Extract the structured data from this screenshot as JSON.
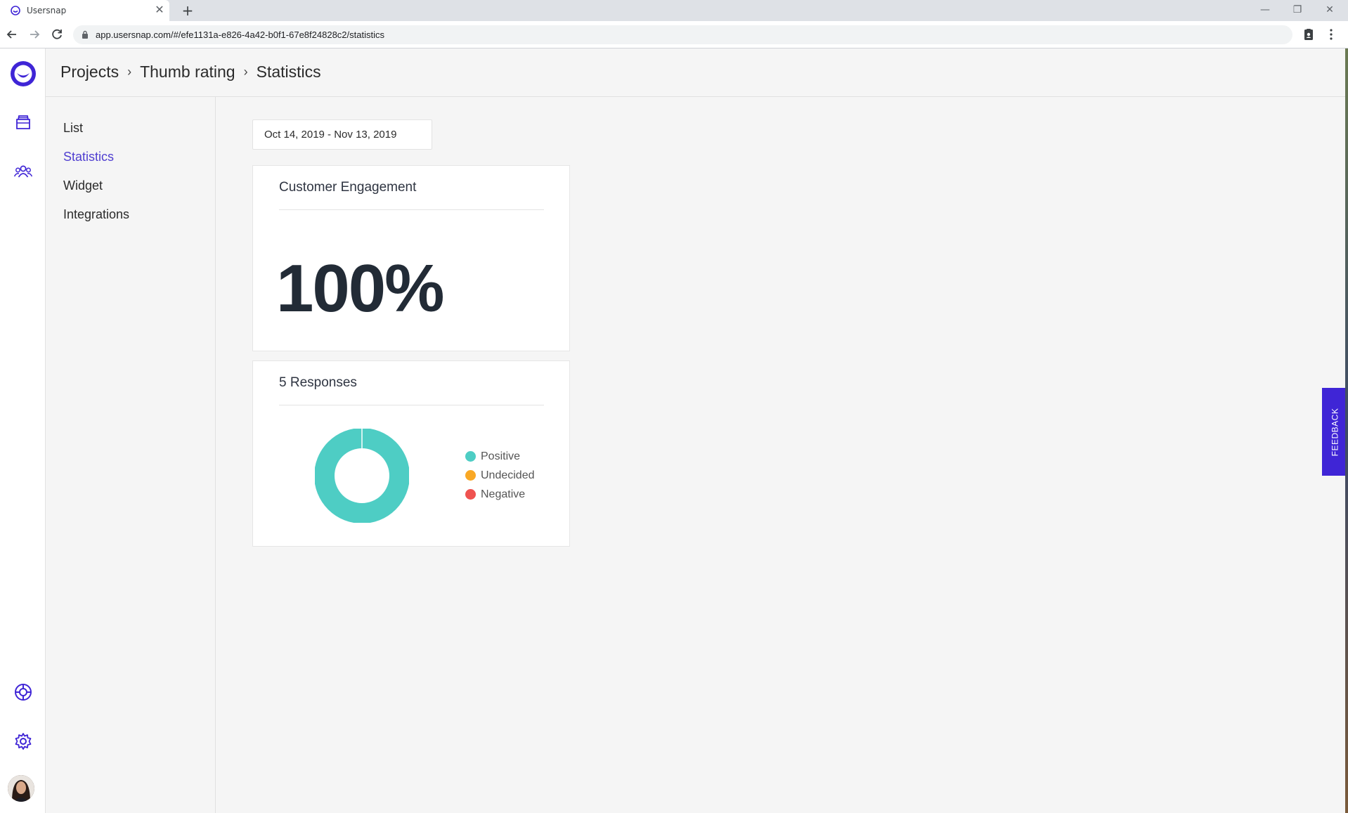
{
  "browser": {
    "tab_title": "Usersnap",
    "url": "app.usersnap.com/#/efe1131a-e826-4a42-b0f1-67e8f24828c2/statistics",
    "tab_close_glyph": "✕",
    "new_tab_glyph": "+",
    "minimize_glyph": "—",
    "restore_glyph": "❐",
    "close_glyph": "✕"
  },
  "breadcrumb": {
    "items": [
      "Projects",
      "Thumb rating",
      "Statistics"
    ],
    "separator": "›"
  },
  "subnav": {
    "items": [
      {
        "label": "List",
        "active": false
      },
      {
        "label": "Statistics",
        "active": true
      },
      {
        "label": "Widget",
        "active": false
      },
      {
        "label": "Integrations",
        "active": false
      }
    ]
  },
  "date_range": "Oct 14, 2019 - Nov 13, 2019",
  "engagement_card": {
    "title": "Customer Engagement",
    "value": "100%"
  },
  "responses_card": {
    "title": "5 Responses",
    "legend": [
      {
        "label": "Positive",
        "color": "#4ecdc4"
      },
      {
        "label": "Undecided",
        "color": "#f9a825"
      },
      {
        "label": "Negative",
        "color": "#ef5350"
      }
    ]
  },
  "chart_data": {
    "type": "pie",
    "categories": [
      "Positive",
      "Undecided",
      "Negative"
    ],
    "values": [
      5,
      0,
      0
    ],
    "colors": [
      "#4ecdc4",
      "#f9a825",
      "#ef5350"
    ],
    "donut": true,
    "legend_position": "right"
  },
  "feedback_label": "FEEDBACK",
  "icons": {
    "logo": "usersnap-logo-icon",
    "projects": "inbox-icon",
    "team": "team-icon",
    "help": "lifebuoy-icon",
    "settings": "gear-icon"
  },
  "colors": {
    "brand": "#3f25d6",
    "active_nav": "#4f3ed0"
  }
}
